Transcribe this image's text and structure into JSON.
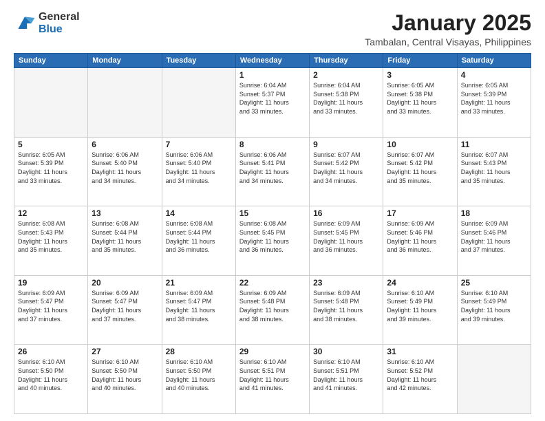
{
  "header": {
    "logo_general": "General",
    "logo_blue": "Blue",
    "title": "January 2025",
    "location": "Tambalan, Central Visayas, Philippines"
  },
  "weekdays": [
    "Sunday",
    "Monday",
    "Tuesday",
    "Wednesday",
    "Thursday",
    "Friday",
    "Saturday"
  ],
  "weeks": [
    [
      {
        "day": "",
        "info": ""
      },
      {
        "day": "",
        "info": ""
      },
      {
        "day": "",
        "info": ""
      },
      {
        "day": "1",
        "info": "Sunrise: 6:04 AM\nSunset: 5:37 PM\nDaylight: 11 hours\nand 33 minutes."
      },
      {
        "day": "2",
        "info": "Sunrise: 6:04 AM\nSunset: 5:38 PM\nDaylight: 11 hours\nand 33 minutes."
      },
      {
        "day": "3",
        "info": "Sunrise: 6:05 AM\nSunset: 5:38 PM\nDaylight: 11 hours\nand 33 minutes."
      },
      {
        "day": "4",
        "info": "Sunrise: 6:05 AM\nSunset: 5:39 PM\nDaylight: 11 hours\nand 33 minutes."
      }
    ],
    [
      {
        "day": "5",
        "info": "Sunrise: 6:05 AM\nSunset: 5:39 PM\nDaylight: 11 hours\nand 33 minutes."
      },
      {
        "day": "6",
        "info": "Sunrise: 6:06 AM\nSunset: 5:40 PM\nDaylight: 11 hours\nand 34 minutes."
      },
      {
        "day": "7",
        "info": "Sunrise: 6:06 AM\nSunset: 5:40 PM\nDaylight: 11 hours\nand 34 minutes."
      },
      {
        "day": "8",
        "info": "Sunrise: 6:06 AM\nSunset: 5:41 PM\nDaylight: 11 hours\nand 34 minutes."
      },
      {
        "day": "9",
        "info": "Sunrise: 6:07 AM\nSunset: 5:42 PM\nDaylight: 11 hours\nand 34 minutes."
      },
      {
        "day": "10",
        "info": "Sunrise: 6:07 AM\nSunset: 5:42 PM\nDaylight: 11 hours\nand 35 minutes."
      },
      {
        "day": "11",
        "info": "Sunrise: 6:07 AM\nSunset: 5:43 PM\nDaylight: 11 hours\nand 35 minutes."
      }
    ],
    [
      {
        "day": "12",
        "info": "Sunrise: 6:08 AM\nSunset: 5:43 PM\nDaylight: 11 hours\nand 35 minutes."
      },
      {
        "day": "13",
        "info": "Sunrise: 6:08 AM\nSunset: 5:44 PM\nDaylight: 11 hours\nand 35 minutes."
      },
      {
        "day": "14",
        "info": "Sunrise: 6:08 AM\nSunset: 5:44 PM\nDaylight: 11 hours\nand 36 minutes."
      },
      {
        "day": "15",
        "info": "Sunrise: 6:08 AM\nSunset: 5:45 PM\nDaylight: 11 hours\nand 36 minutes."
      },
      {
        "day": "16",
        "info": "Sunrise: 6:09 AM\nSunset: 5:45 PM\nDaylight: 11 hours\nand 36 minutes."
      },
      {
        "day": "17",
        "info": "Sunrise: 6:09 AM\nSunset: 5:46 PM\nDaylight: 11 hours\nand 36 minutes."
      },
      {
        "day": "18",
        "info": "Sunrise: 6:09 AM\nSunset: 5:46 PM\nDaylight: 11 hours\nand 37 minutes."
      }
    ],
    [
      {
        "day": "19",
        "info": "Sunrise: 6:09 AM\nSunset: 5:47 PM\nDaylight: 11 hours\nand 37 minutes."
      },
      {
        "day": "20",
        "info": "Sunrise: 6:09 AM\nSunset: 5:47 PM\nDaylight: 11 hours\nand 37 minutes."
      },
      {
        "day": "21",
        "info": "Sunrise: 6:09 AM\nSunset: 5:47 PM\nDaylight: 11 hours\nand 38 minutes."
      },
      {
        "day": "22",
        "info": "Sunrise: 6:09 AM\nSunset: 5:48 PM\nDaylight: 11 hours\nand 38 minutes."
      },
      {
        "day": "23",
        "info": "Sunrise: 6:09 AM\nSunset: 5:48 PM\nDaylight: 11 hours\nand 38 minutes."
      },
      {
        "day": "24",
        "info": "Sunrise: 6:10 AM\nSunset: 5:49 PM\nDaylight: 11 hours\nand 39 minutes."
      },
      {
        "day": "25",
        "info": "Sunrise: 6:10 AM\nSunset: 5:49 PM\nDaylight: 11 hours\nand 39 minutes."
      }
    ],
    [
      {
        "day": "26",
        "info": "Sunrise: 6:10 AM\nSunset: 5:50 PM\nDaylight: 11 hours\nand 40 minutes."
      },
      {
        "day": "27",
        "info": "Sunrise: 6:10 AM\nSunset: 5:50 PM\nDaylight: 11 hours\nand 40 minutes."
      },
      {
        "day": "28",
        "info": "Sunrise: 6:10 AM\nSunset: 5:50 PM\nDaylight: 11 hours\nand 40 minutes."
      },
      {
        "day": "29",
        "info": "Sunrise: 6:10 AM\nSunset: 5:51 PM\nDaylight: 11 hours\nand 41 minutes."
      },
      {
        "day": "30",
        "info": "Sunrise: 6:10 AM\nSunset: 5:51 PM\nDaylight: 11 hours\nand 41 minutes."
      },
      {
        "day": "31",
        "info": "Sunrise: 6:10 AM\nSunset: 5:52 PM\nDaylight: 11 hours\nand 42 minutes."
      },
      {
        "day": "",
        "info": ""
      }
    ]
  ]
}
